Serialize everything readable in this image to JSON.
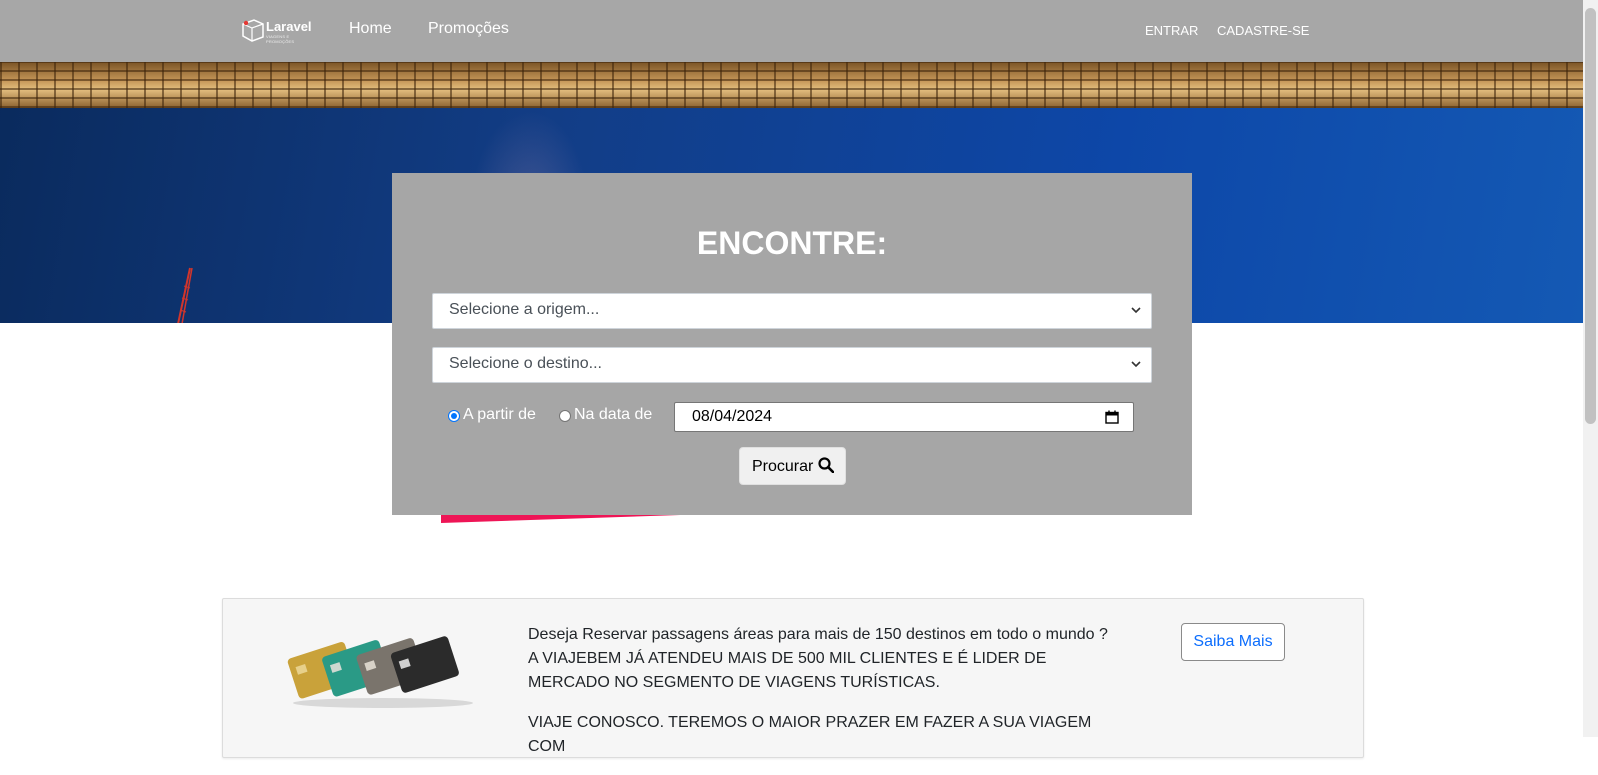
{
  "navbar": {
    "logo_text": "Laravel",
    "logo_sub": "VIAGENS E PROMOÇÕES",
    "links": [
      "Home",
      "Promoções"
    ],
    "login": "ENTRAR",
    "signup": "CADASTRE-SE"
  },
  "search": {
    "title": "ENCONTRE:",
    "origin_placeholder": "Selecione a origem...",
    "destination_placeholder": "Selecione o destino...",
    "radio_from": "A partir de",
    "radio_on": "Na data de",
    "radio_selected": "A partir de",
    "date_value": "08/04/2024",
    "button_label": "Procurar"
  },
  "promo": {
    "line1": "Deseja Reservar passagens áreas para mais de 150 destinos em todo o mundo ?",
    "line2": "A VIAJEBEM JÁ ATENDEU MAIS DE 500 MIL CLIENTES E É LIDER DE MERCADO NO SEGMENTO DE VIAGENS TURÍSTICAS.",
    "line3": "VIAJE CONOSCO. TEREMOS O MAIOR PRAZER EM FAZER A SUA VIAGEM COM",
    "button_label": "Saiba Mais"
  },
  "colors": {
    "navbar": "#a7a7a7",
    "card": "#a6a6a6",
    "accent": "#ee1556",
    "link": "#0d6efd"
  }
}
